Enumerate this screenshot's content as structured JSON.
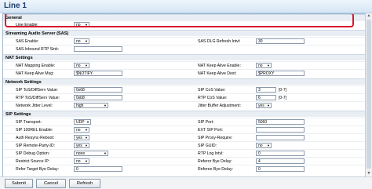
{
  "window": {
    "title": "Line 1"
  },
  "sections": {
    "general": "General",
    "sas": "Streaming Audio Server (SAS)",
    "nat": "NAT Settings",
    "network": "Network Settings",
    "sip": "SIP Settings"
  },
  "general": {
    "line_enable": {
      "label": "Line Enable:",
      "value": "no"
    }
  },
  "sas": {
    "sas_enable": {
      "label": "SAS Enable:",
      "value": "no"
    },
    "sas_dlg_refresh": {
      "label": "SAS DLG Refresh Intvl:",
      "value": "30"
    },
    "sas_rtp_sink": {
      "label": "SAS Inbound RTP Sink:",
      "value": ""
    }
  },
  "nat": {
    "nat_mapping": {
      "label": "NAT Mapping Enable:",
      "value": "no"
    },
    "nat_keep_alive_enable": {
      "label": "NAT Keep Alive Enable:",
      "value": "no"
    },
    "nat_keep_alive_msg": {
      "label": "NAT Keep Alive Msg:",
      "value": "$NOTIFY"
    },
    "nat_keep_alive_dest": {
      "label": "NAT Keep Alive Dest:",
      "value": "$PROXY"
    }
  },
  "network": {
    "sip_tos": {
      "label": "SIP ToS/DiffServ Value:",
      "value": "0x68"
    },
    "sip_cos": {
      "label": "SIP CoS Value:",
      "value": "3",
      "hint": "[0-7]"
    },
    "rtp_tos": {
      "label": "RTP ToS/DiffServ Value:",
      "value": "0xb8"
    },
    "rtp_cos": {
      "label": "RTP CoS Value:",
      "value": "6",
      "hint": "[0-7]"
    },
    "jitter_level": {
      "label": "Network Jitter Level:",
      "value": "high"
    },
    "jitter_adjust": {
      "label": "Jitter Buffer Adjustment:",
      "value": "yes"
    }
  },
  "sip": {
    "transport": {
      "label": "SIP Transport:",
      "value": "UDP"
    },
    "port": {
      "label": "SIP Port:",
      "value": "5060"
    },
    "rel100": {
      "label": "SIP 100REL Enable:",
      "value": "no"
    },
    "ext_port": {
      "label": "EXT SIP Port:",
      "value": ""
    },
    "auth_resync": {
      "label": "Auth Resync-Reboot:",
      "value": "yes"
    },
    "proxy_require": {
      "label": "SIP Proxy-Require:",
      "value": ""
    },
    "remote_party": {
      "label": "SIP Remote-Party-ID:",
      "value": "yes"
    },
    "guid": {
      "label": "SIP GUID:",
      "value": "no"
    },
    "debug_option": {
      "label": "SIP Debug Option:",
      "value": "none"
    },
    "rtp_log": {
      "label": "RTP Log Intvl:",
      "value": "0"
    },
    "restrict_source": {
      "label": "Restrict Source IP:",
      "value": "no"
    },
    "referor_bye": {
      "label": "Referor Bye Delay:",
      "value": "4"
    },
    "refer_target_bye": {
      "label": "Refer Target Bye Delay:",
      "value": "0"
    },
    "referee_bye": {
      "label": "Referee Bye Delay:",
      "value": "0"
    }
  },
  "buttons": {
    "submit": "Submit",
    "cancel": "Cancel",
    "refresh": "Refresh"
  },
  "colors": {
    "highlight": "#d4172d",
    "title": "#1f3f6e"
  }
}
